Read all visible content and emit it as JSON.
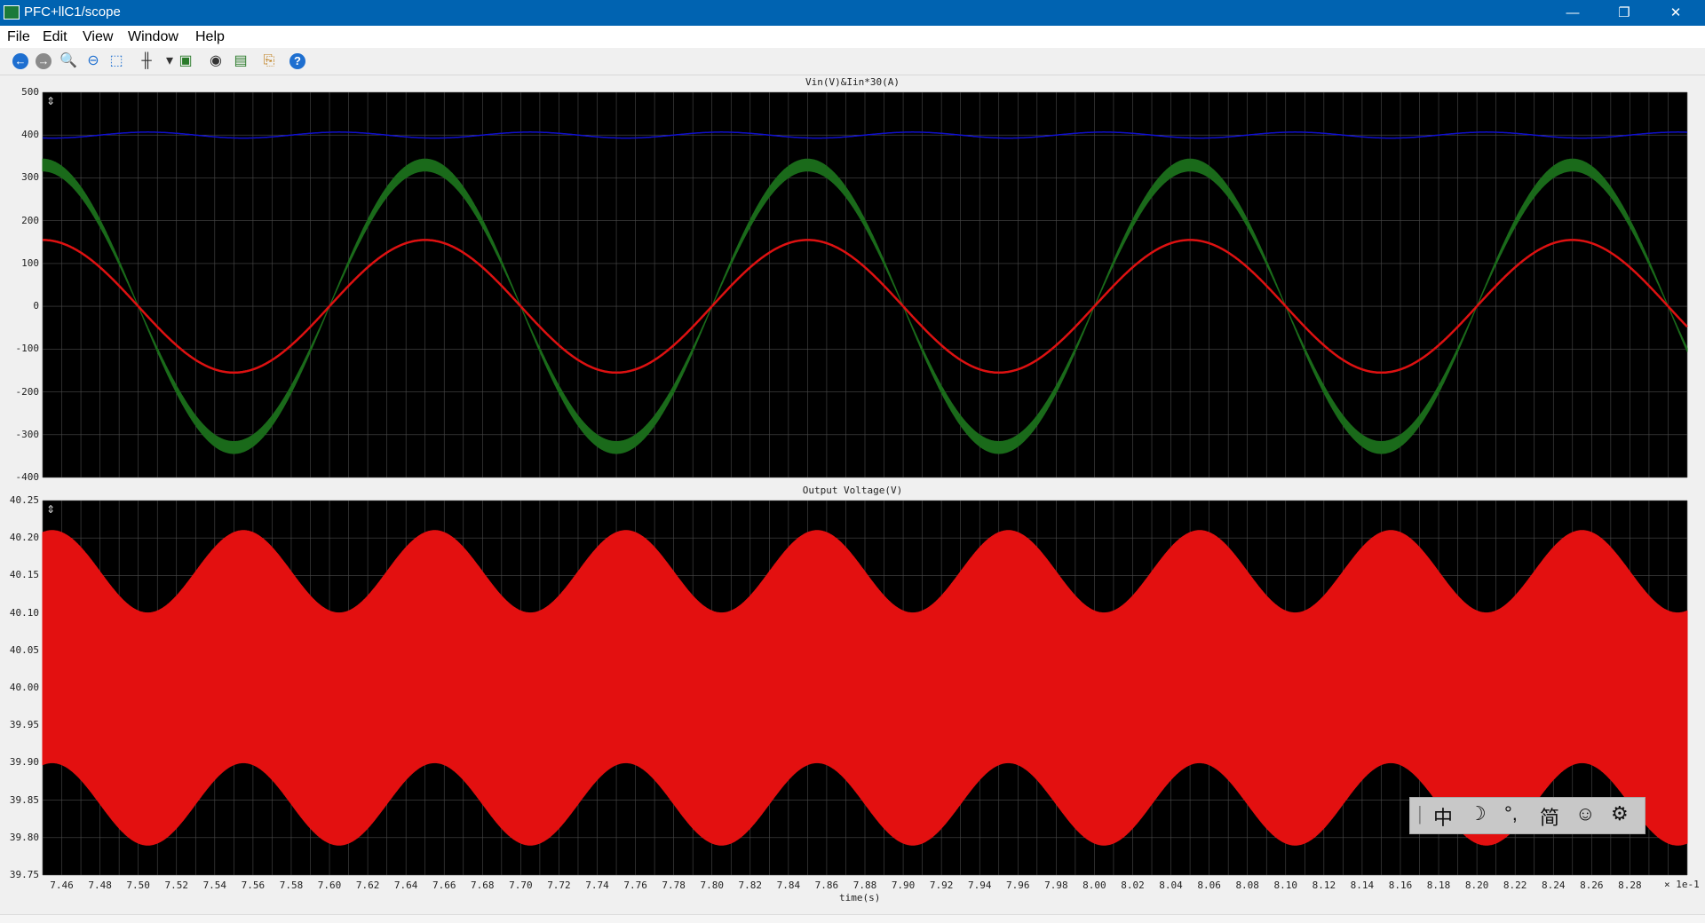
{
  "window": {
    "title": "PFC+llC1/scope",
    "minimize": "—",
    "restore": "❐",
    "close": "✕"
  },
  "menu": [
    "File",
    "Edit",
    "View",
    "Window",
    "Help"
  ],
  "toolbar": [
    {
      "icon": "back-icon",
      "glyph": "←",
      "color": "#1e6fd0"
    },
    {
      "icon": "forward-icon",
      "glyph": "→",
      "color": "#8a8a8a"
    },
    {
      "icon": "zoom-in-icon",
      "glyph": "🔍",
      "color": "#1e6fd0"
    },
    {
      "icon": "zoom-out-icon",
      "glyph": "⊖",
      "color": "#1e6fd0"
    },
    {
      "icon": "zoom-fit-icon",
      "glyph": "⬚",
      "color": "#1e6fd0"
    },
    {
      "icon": "cursor-icon",
      "glyph": "╫",
      "color": "#333333"
    },
    {
      "icon": "dropdown-icon",
      "glyph": "▾",
      "color": "#333333"
    },
    {
      "icon": "display-icon",
      "glyph": "▣",
      "color": "#2a7a2a"
    },
    {
      "icon": "eye-icon",
      "glyph": "◉",
      "color": "#333333"
    },
    {
      "icon": "screen-icon",
      "glyph": "▤",
      "color": "#2a7a2a"
    },
    {
      "icon": "export-icon",
      "glyph": "⎘",
      "color": "#c08020"
    },
    {
      "icon": "help-icon",
      "glyph": "?",
      "color": "#1e6fd0"
    }
  ],
  "ime": [
    "中",
    "☽",
    "°,",
    "简",
    "☺",
    "⚙"
  ],
  "chart_data": [
    {
      "type": "line",
      "title": "Vin(V)&Iin*30(A)",
      "ylim": [
        -400,
        500
      ],
      "yticks": [
        "500",
        "400",
        "300",
        "200",
        "100",
        "0",
        "-100",
        "-200",
        "-300",
        "-400"
      ],
      "xlim": [
        7.45,
        8.31
      ],
      "grid": true,
      "series": [
        {
          "color": "#1010cc",
          "kind": "dc",
          "offset": 400,
          "amplitude": 7,
          "period_s": 0.1,
          "phase_s": 7.58
        },
        {
          "color": "#1a6a1a",
          "kind": "sine",
          "amplitude": 330,
          "ripple": 14,
          "period_s": 0.2,
          "zero_s": 7.4
        },
        {
          "color": "#dd1111",
          "kind": "sine",
          "amplitude": 155,
          "period_s": 0.2,
          "zero_s": 7.4
        }
      ]
    },
    {
      "type": "line",
      "title": "Output Voltage(V)",
      "ylim": [
        39.75,
        40.25
      ],
      "yticks": [
        "40.25",
        "40.20",
        "40.15",
        "40.10",
        "40.05",
        "40.00",
        "39.95",
        "39.90",
        "39.85",
        "39.80",
        "39.75"
      ],
      "xlim": [
        7.45,
        8.31
      ],
      "xticks": [
        "7.46",
        "7.48",
        "7.50",
        "7.52",
        "7.54",
        "7.56",
        "7.58",
        "7.60",
        "7.62",
        "7.64",
        "7.66",
        "7.68",
        "7.70",
        "7.72",
        "7.74",
        "7.76",
        "7.78",
        "7.80",
        "7.82",
        "7.84",
        "7.86",
        "7.88",
        "7.90",
        "7.92",
        "7.94",
        "7.96",
        "7.98",
        "8.00",
        "8.02",
        "8.04",
        "8.06",
        "8.08",
        "8.10",
        "8.12",
        "8.14",
        "8.16",
        "8.18",
        "8.20",
        "8.22",
        "8.24",
        "8.26",
        "8.28"
      ],
      "xlabel": "time(s)",
      "xscale_label": "1e-1",
      "grid": true,
      "series": [
        {
          "color": "#e31010",
          "kind": "ripple-band",
          "center": 40.0,
          "upper_amplitude": 0.1,
          "lower_amplitude": 0.2,
          "band_top": [
            40.1,
            40.21
          ],
          "band_bottom": [
            39.79,
            39.9
          ],
          "period_s": 0.1,
          "peak_s": 7.45
        }
      ]
    }
  ]
}
